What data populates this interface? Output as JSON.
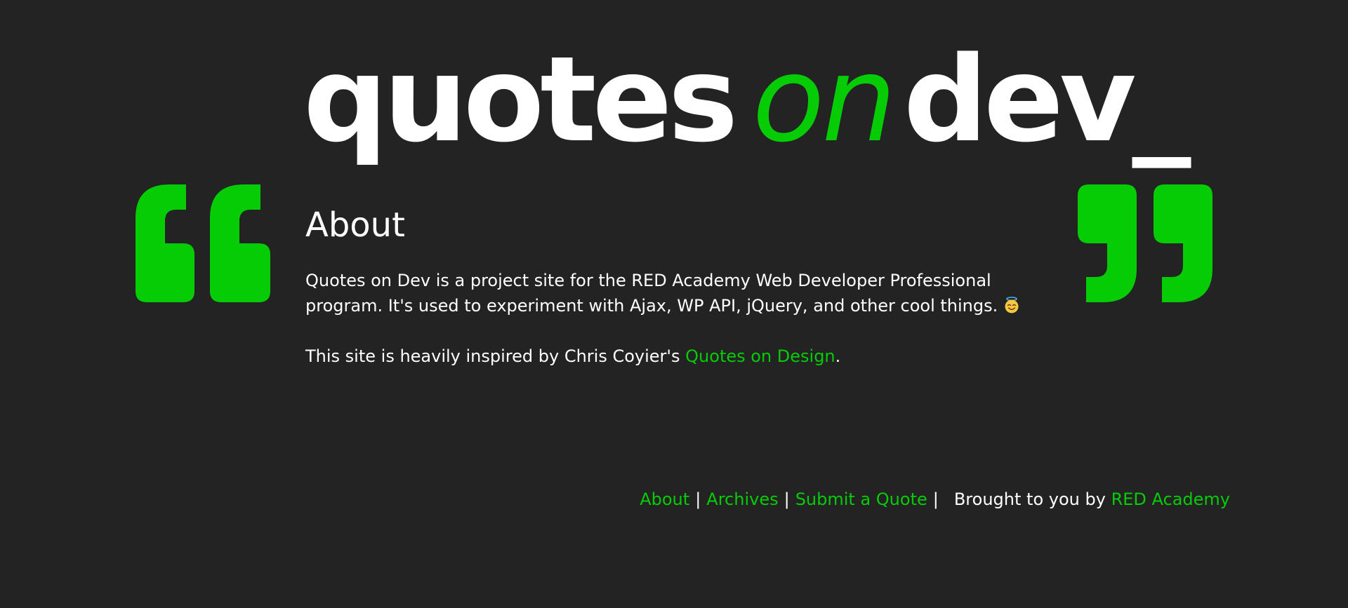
{
  "site": {
    "logo_word_1": "quotes",
    "logo_word_2": "on",
    "logo_word_3": "dev_"
  },
  "main": {
    "title": "About",
    "intro_text": "Quotes on Dev is a project site for the RED Academy Web Developer Professional program. It's used to experiment with Ajax, WP API, jQuery, and other cool things.",
    "emoji": "smiling-face-with-halo",
    "inspired_prefix": "This site is heavily inspired by Chris Coyier's",
    "inspired_link": "Quotes on Design",
    "inspired_suffix": "."
  },
  "footer": {
    "nav": [
      {
        "label": "About"
      },
      {
        "label": "Archives"
      },
      {
        "label": "Submit a Quote"
      }
    ],
    "separator": "|",
    "credit_prefix": "Brought to you by",
    "credit_link": "RED Academy"
  },
  "colors": {
    "background": "#232323",
    "accent": "#05cc05",
    "text": "#ffffff"
  },
  "icons": {
    "left": "open-quote-icon",
    "right": "close-quote-icon"
  }
}
